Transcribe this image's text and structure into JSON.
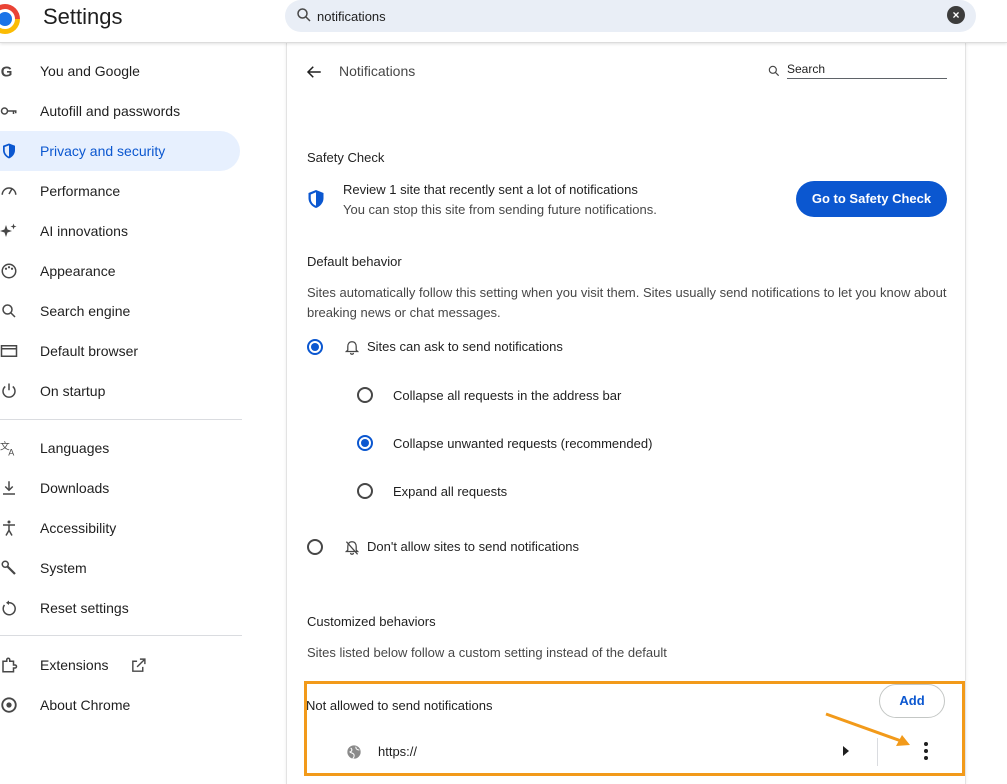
{
  "app": {
    "title": "Settings"
  },
  "search": {
    "value": "notifications"
  },
  "sidebar": {
    "items": [
      {
        "label": "You and Google",
        "icon": "google-icon"
      },
      {
        "label": "Autofill and passwords",
        "icon": "key-icon"
      },
      {
        "label": "Privacy and security",
        "icon": "shield-icon",
        "active": true
      },
      {
        "label": "Performance",
        "icon": "speedometer-icon"
      },
      {
        "label": "AI innovations",
        "icon": "sparkle-icon"
      },
      {
        "label": "Appearance",
        "icon": "palette-icon"
      },
      {
        "label": "Search engine",
        "icon": "search-icon"
      },
      {
        "label": "Default browser",
        "icon": "browser-window-icon"
      },
      {
        "label": "On startup",
        "icon": "power-icon"
      },
      {
        "label": "Languages",
        "icon": "translate-icon"
      },
      {
        "label": "Downloads",
        "icon": "download-icon"
      },
      {
        "label": "Accessibility",
        "icon": "accessibility-icon"
      },
      {
        "label": "System",
        "icon": "wrench-icon"
      },
      {
        "label": "Reset settings",
        "icon": "reset-icon"
      },
      {
        "label": "Extensions",
        "icon": "puzzle-icon"
      },
      {
        "label": "About Chrome",
        "icon": "chrome-icon"
      }
    ]
  },
  "page": {
    "title": "Notifications",
    "search_placeholder": "Search",
    "safety_check": {
      "heading": "Safety Check",
      "title": "Review 1 site that recently sent a lot of notifications",
      "subtitle": "You can stop this site from sending future notifications.",
      "button": "Go to Safety Check"
    },
    "default_behavior": {
      "heading": "Default behavior",
      "description": "Sites automatically follow this setting when you visit them. Sites usually send notifications to let you know about breaking news or chat messages.",
      "allow_option": "Sites can ask to send notifications",
      "sub_options": [
        "Collapse all requests in the address bar",
        "Collapse unwanted requests (recommended)",
        "Expand all requests"
      ],
      "block_option": "Don't allow sites to send notifications"
    },
    "customized": {
      "heading": "Customized behaviors",
      "description": "Sites listed below follow a custom setting instead of the default",
      "not_allowed_label": "Not allowed to send notifications",
      "add_button": "Add",
      "site": "https://"
    }
  },
  "colors": {
    "accent": "#0b57d0",
    "highlight": "#f29a1a",
    "active_bg": "#e7f0fe"
  }
}
